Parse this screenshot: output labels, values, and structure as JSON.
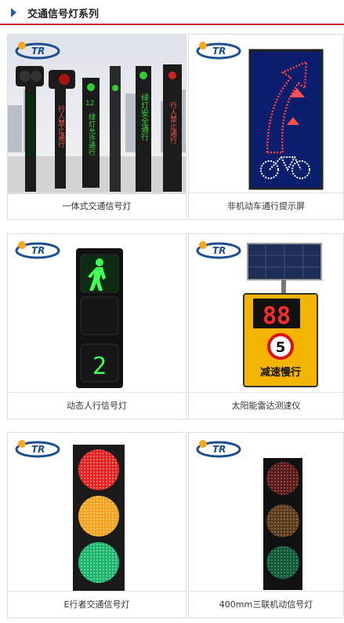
{
  "header": {
    "title": "交通信号灯系列"
  },
  "products": [
    {
      "caption": "一体式交通信号灯",
      "post_texts": [
        "行人禁止通行",
        "绿灯允许通行",
        "绿灯安全通行",
        "行人禁止通行"
      ],
      "counter": "12"
    },
    {
      "caption": "非机动车通行提示屏"
    },
    {
      "caption": "动态人行信号灯",
      "countdown": "2"
    },
    {
      "caption": "太阳能雷达测速仪",
      "speed_display": "88",
      "limit": "5",
      "sign_text": "减速慢行"
    },
    {
      "caption": "E行者交通信号灯"
    },
    {
      "caption": "400mm三联机动信号灯"
    }
  ]
}
